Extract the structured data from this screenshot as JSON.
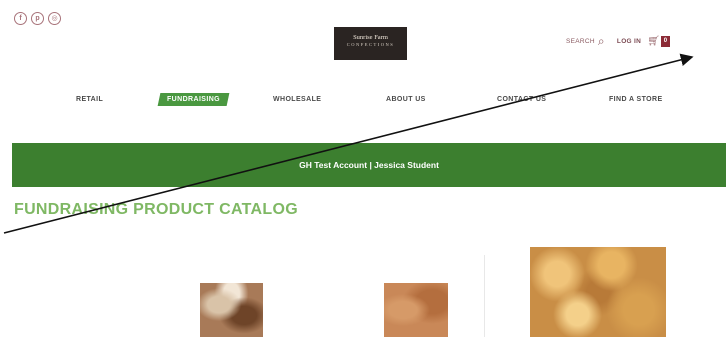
{
  "social": {
    "icons": [
      "facebook-icon",
      "pinterest-icon",
      "instagram-icon"
    ],
    "glyphs": [
      "f",
      "p",
      "◎"
    ]
  },
  "logo": {
    "line1": "Sunrise Farm",
    "line2": "CONFECTIONS"
  },
  "header": {
    "search_label": "SEARCH",
    "login_label": "LOG IN",
    "cart_count": "0"
  },
  "nav": {
    "items": [
      {
        "label": "RETAIL",
        "active": false
      },
      {
        "label": "FUNDRAISING",
        "active": true
      },
      {
        "label": "WHOLESALE",
        "active": false
      },
      {
        "label": "ABOUT US",
        "active": false
      },
      {
        "label": "CONTACT US",
        "active": false
      },
      {
        "label": "FIND A STORE",
        "active": false
      }
    ]
  },
  "banner": {
    "text": "GH Test Account | Jessica Student"
  },
  "catalog": {
    "title": "FUNDRAISING PRODUCT CATALOG"
  },
  "colors": {
    "brand_green": "#3c7f2f",
    "nav_active": "#4a9840",
    "title_green": "#7fb864",
    "cart_badge": "#8c2b36",
    "accent": "#8a5a60"
  },
  "products": [
    {
      "image": "cookie-assortment-image"
    },
    {
      "image": "cookie-stack-image"
    },
    {
      "image": "nut-brittle-image"
    }
  ]
}
